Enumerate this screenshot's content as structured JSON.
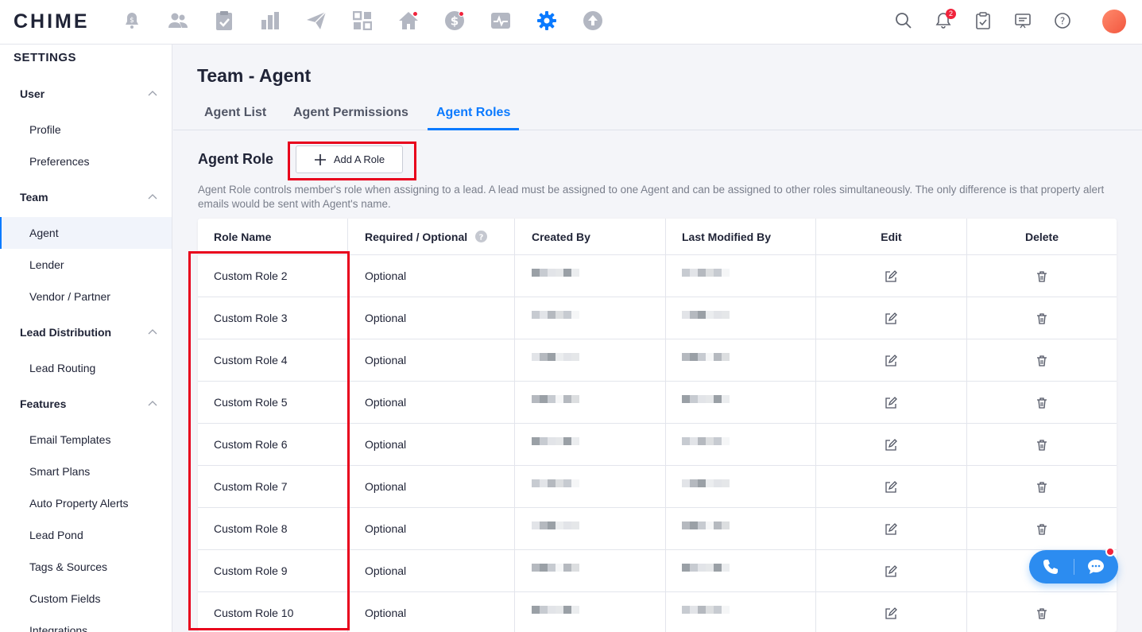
{
  "app": {
    "logo": "CHIME"
  },
  "topnav": {
    "icons": [
      "lead-bell-icon",
      "people-icon",
      "clipboard-check-icon",
      "bar-chart-icon",
      "paper-plane-icon",
      "apps-grid-icon",
      "home-icon",
      "dollar-icon",
      "activity-icon",
      "settings-gear-icon",
      "upload-icon"
    ],
    "notification_count": "2"
  },
  "sidebar": {
    "title": "SETTINGS",
    "groups": [
      {
        "label": "User",
        "items": [
          "Profile",
          "Preferences"
        ]
      },
      {
        "label": "Team",
        "items": [
          "Agent",
          "Lender",
          "Vendor / Partner"
        ]
      },
      {
        "label": "Lead Distribution",
        "items": [
          "Lead Routing"
        ]
      },
      {
        "label": "Features",
        "items": [
          "Email Templates",
          "Smart Plans",
          "Auto Property Alerts",
          "Lead Pond",
          "Tags & Sources",
          "Custom Fields",
          "Integrations"
        ]
      }
    ],
    "active_item": "Agent"
  },
  "main": {
    "title": "Team - Agent",
    "tabs": [
      "Agent List",
      "Agent Permissions",
      "Agent Roles"
    ],
    "active_tab": "Agent Roles",
    "section_title": "Agent Role",
    "add_button": "Add A Role",
    "description": "Agent Role controls member's role when assigning to a lead. A lead must be assigned to one Agent and can be assigned to other roles simultaneously. The only difference is that property alert emails would be sent with Agent's name."
  },
  "table": {
    "headers": [
      "Role Name",
      "Required / Optional",
      "Created By",
      "Last Modified By",
      "Edit",
      "Delete"
    ],
    "rows": [
      {
        "role": "Custom Role 2",
        "req": "Optional"
      },
      {
        "role": "Custom Role 3",
        "req": "Optional"
      },
      {
        "role": "Custom Role 4",
        "req": "Optional"
      },
      {
        "role": "Custom Role 5",
        "req": "Optional"
      },
      {
        "role": "Custom Role 6",
        "req": "Optional"
      },
      {
        "role": "Custom Role 7",
        "req": "Optional"
      },
      {
        "role": "Custom Role 8",
        "req": "Optional"
      },
      {
        "role": "Custom Role 9",
        "req": "Optional"
      },
      {
        "role": "Custom Role 10",
        "req": "Optional"
      }
    ]
  },
  "colors": {
    "accent": "#0a7aff",
    "highlight": "#e8001c",
    "float_button": "#2c8cf0"
  }
}
